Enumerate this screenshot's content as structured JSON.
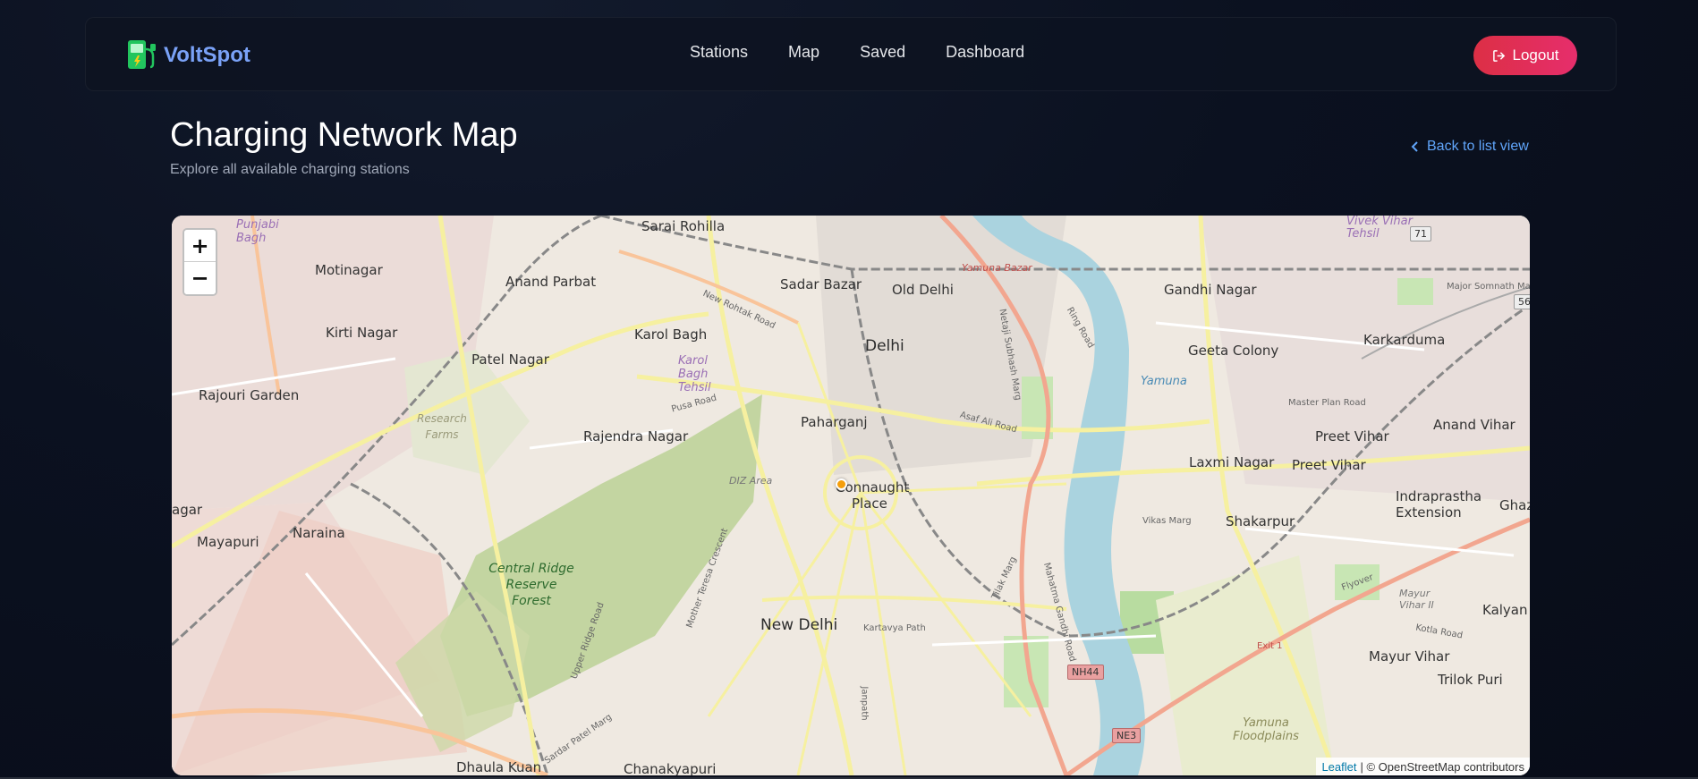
{
  "brand": {
    "name": "VoltSpot",
    "icon": "ev-charger-icon"
  },
  "nav": {
    "stations": "Stations",
    "map": "Map",
    "saved": "Saved",
    "dashboard": "Dashboard"
  },
  "logout": {
    "label": "Logout",
    "icon": "logout-icon"
  },
  "page": {
    "title": "Charging Network Map",
    "subtitle": "Explore all available charging stations",
    "back_link": "Back to list view"
  },
  "map": {
    "zoom_in": "+",
    "zoom_out": "−",
    "attribution_link": "Leaflet",
    "attribution_text": "| © OpenStreetMap contributors",
    "marker_color": "#f59e0b",
    "labels": {
      "sarai_rohilla": "Sarai Rohilla",
      "punjabi_bagh": "Punjabi Bagh",
      "motinagar": "Motinagar",
      "anand_parbat": "Anand Parbat",
      "sadar_bazar": "Sadar Bazar",
      "old_delhi": "Old Delhi",
      "yamuna_bazar": "Yamuna Bazar",
      "gandhi_nagar": "Gandhi Nagar",
      "vivek_vihar": "Vivek Vihar Tehsil",
      "kirti_nagar": "Kirti Nagar",
      "karol_bagh": "Karol Bagh",
      "karol_bagh_tehsil": "Karol Bagh Tehsil",
      "patel_nagar": "Patel Nagar",
      "delhi": "Delhi",
      "geeta_colony": "Geeta Colony",
      "karkarduma": "Karkarduma",
      "rajouri_garden": "Rajouri Garden",
      "research_farms": "Research Farms",
      "paharganj": "Paharganj",
      "yamuna": "Yamuna",
      "anand_vihar": "Anand Vihar",
      "rajendra_nagar": "Rajendra Nagar",
      "preet_vihar_1": "Preet Vihar",
      "laxmi_nagar": "Laxmi Nagar",
      "preet_vihar_2": "Preet Vihar",
      "diz_area": "DIZ Area",
      "connaught": "Connaught",
      "place": "Place",
      "indraprastha": "Indraprastha Extension",
      "nagar": "agar",
      "shakarpur": "Shakarpur",
      "ghaz": "Ghaz",
      "mayapuri": "Mayapuri",
      "naraina": "Naraina",
      "central_ridge": "Central Ridge Reserve Forest",
      "new_delhi": "New Delhi",
      "kartavya_path": "Kartavya Path",
      "mayur_vihar_ii": "Mayur Vihar II",
      "kalyan_pu": "Kalyan Pu",
      "mayur_vihar": "Mayur Vihar",
      "trilok_puri": "Trilok Puri",
      "yamuna_floodplains": "Yamuna Floodplains",
      "dhaula_kuan": "Dhaula Kuan",
      "chanakyapuri": "Chanakyapuri",
      "nh44": "NH44",
      "ne3": "NE3",
      "road_71": "71",
      "road_56": "56",
      "vikas_marg": "Vikas Marg",
      "master_plan_road": "Master Plan Road",
      "pusa_road": "Pusa Road",
      "ring_road": "Ring Road",
      "asaf_ali_road": "Asaf Ali Road",
      "flyover": "Flyover",
      "exit_1": "Exit 1",
      "janpath": "Janpath",
      "tilak_marg": "Tilak Marg",
      "netaji_subhash_marg": "Netaji Subhash Marg",
      "mahatma_gandhi_road": "Mahatma Gandhi Road",
      "new_rohtak_road": "New Rohtak Road",
      "major_somnath_marg": "Major Somnath Marg",
      "kotla_road": "Kotla Road",
      "sardar_patel_marg": "Sardar Patel Marg",
      "mother_teresa_crescent": "Mother Teresa Crescent",
      "upper_ridge_road": "Upper Ridge Road"
    }
  }
}
